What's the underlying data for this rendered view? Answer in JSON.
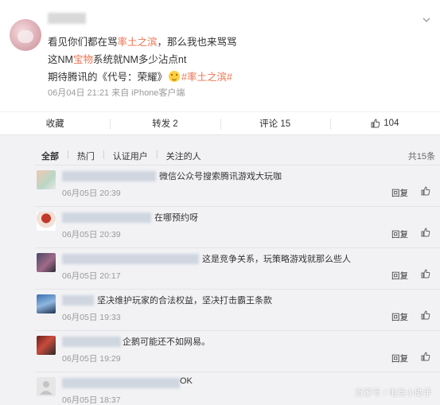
{
  "post": {
    "line1_prefix": "看见你们都在骂",
    "line1_hl": "率土之滨",
    "line1_suffix": "，那么我也来骂骂",
    "line2_prefix": "这NM",
    "line2_hl": "宝物",
    "line2_suffix": "系统就NM多少沾点nt",
    "line3_prefix": "期待腾讯的《代号：荣耀》",
    "line3_tag": "#率土之滨#",
    "meta": "06月04日 21:21  来自 iPhone客户端"
  },
  "actions": {
    "collect": "收藏",
    "repost": "转发 2",
    "comment": "评论 15",
    "like": "104"
  },
  "filters": {
    "all": "全部",
    "hot": "热门",
    "verified": "认证用户",
    "following": "关注的人",
    "sep": "|",
    "count": "共15条"
  },
  "comments": [
    {
      "text": "微信公众号搜索腾讯游戏大玩咖",
      "time": "06月05日 20:39"
    },
    {
      "text": "在哪预约呀",
      "time": "06月05日 20:39"
    },
    {
      "text": "这是竞争关系，玩策略游戏就那么些人",
      "time": "06月05日 20:17"
    },
    {
      "text": "坚决维护玩家的合法权益，坚决打击霸王条款",
      "time": "06月05日 19:33"
    },
    {
      "text": "企鹅可能还不如网易。",
      "time": "06月05日 19:29"
    },
    {
      "text": "OK",
      "time": "06月05日 18:37"
    }
  ],
  "reply_label": "回复",
  "watermark": "百家号 / 电竞小助手",
  "colors": {
    "accent": "#eb7350",
    "topic": "#5d7db3"
  },
  "icons": {
    "like": "thumbs-up-icon",
    "menu": "chevron-down-icon"
  }
}
